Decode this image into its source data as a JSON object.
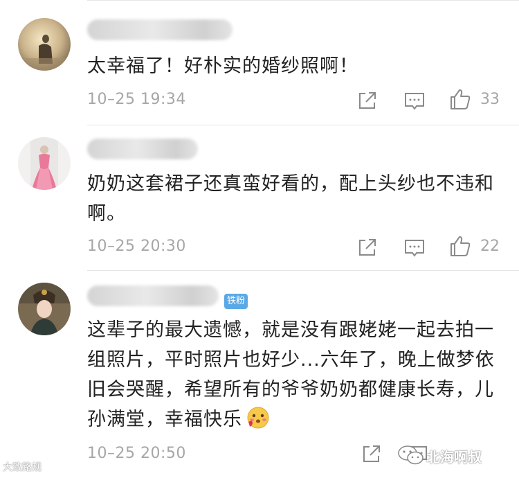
{
  "comments": [
    {
      "text": "太幸福了！好朴实的婚纱照啊！",
      "time": "10–25 19:34",
      "likes": "33",
      "badge": ""
    },
    {
      "text": "奶奶这套裙子还真蛮好看的，配上头纱也不违和啊。",
      "time": "10–25 20:30",
      "likes": "22",
      "badge": ""
    },
    {
      "text": "这辈子的最大遗憾，就是没有跟姥姥一起去拍一组照片，平时照片也好少...六年了，晚上做梦依旧会哭醒，希望所有的爷爷奶奶都健康长寿，儿孙满堂，幸福快乐",
      "time": "10–25 20:50",
      "likes": "",
      "badge": "铁粉"
    }
  ],
  "icons": {
    "share": "share-icon",
    "comment": "comment-icon",
    "like": "thumbs-up-icon",
    "emoji": "blush-emoji-icon"
  },
  "watermarks": {
    "left": "大致路规",
    "right": "北海啊叔"
  },
  "colors": {
    "text": "#222222",
    "meta": "#a6a6a6",
    "badge": "#5aa9e6",
    "divider": "#e6e6e6"
  }
}
